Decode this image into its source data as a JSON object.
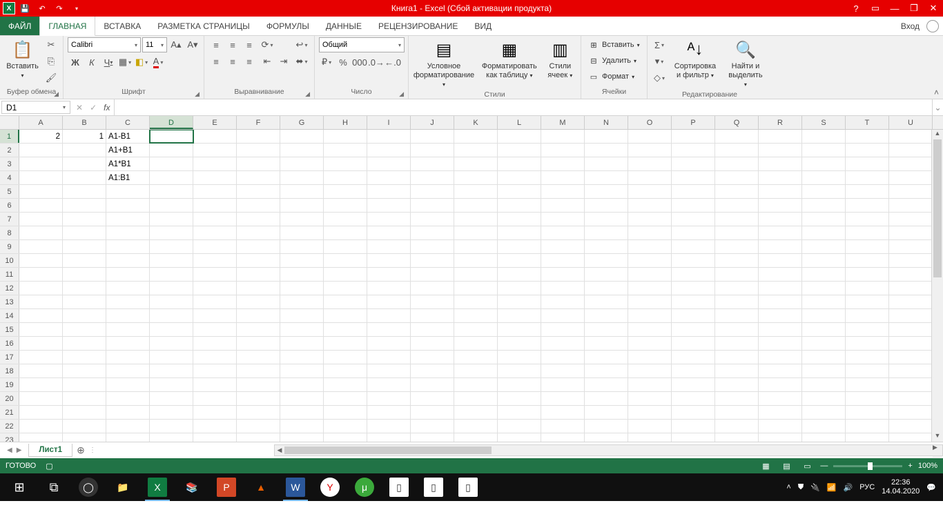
{
  "titlebar": {
    "title": "Книга1 -  Excel (Сбой активации продукта)"
  },
  "tabs": {
    "file": "ФАЙЛ",
    "items": [
      "ГЛАВНАЯ",
      "ВСТАВКА",
      "РАЗМЕТКА СТРАНИЦЫ",
      "ФОРМУЛЫ",
      "ДАННЫЕ",
      "РЕЦЕНЗИРОВАНИЕ",
      "ВИД"
    ],
    "active": 0,
    "signin": "Вход"
  },
  "ribbon": {
    "clipboard": {
      "paste": "Вставить",
      "label": "Буфер обмена"
    },
    "font": {
      "name": "Calibri",
      "size": "11",
      "label": "Шрифт",
      "bold": "Ж",
      "italic": "К",
      "underline": "Ч"
    },
    "alignment": {
      "label": "Выравнивание"
    },
    "number": {
      "format": "Общий",
      "label": "Число"
    },
    "styles": {
      "cond": "Условное форматирование",
      "table": "Форматировать как таблицу",
      "cell": "Стили ячеек",
      "label": "Стили"
    },
    "cells": {
      "insert": "Вставить",
      "delete": "Удалить",
      "format": "Формат",
      "label": "Ячейки"
    },
    "editing": {
      "sort": "Сортировка и фильтр",
      "find": "Найти и выделить",
      "label": "Редактирование"
    }
  },
  "formula_bar": {
    "name": "D1",
    "fx": "fx",
    "value": ""
  },
  "grid": {
    "columns": [
      "A",
      "B",
      "C",
      "D",
      "E",
      "F",
      "G",
      "H",
      "I",
      "J",
      "K",
      "L",
      "M",
      "N",
      "O",
      "P",
      "Q",
      "R",
      "S",
      "T",
      "U"
    ],
    "active_col": 3,
    "active_row": 0,
    "row_count": 23,
    "cells": {
      "A1": "2",
      "B1": "1",
      "C1": "A1-B1",
      "C2": "A1+B1",
      "C3": "A1*B1",
      "C4": "A1:B1"
    }
  },
  "sheets": {
    "tab": "Лист1"
  },
  "statusbar": {
    "ready": "ГОТОВО",
    "zoom": "100%"
  },
  "taskbar": {
    "lang": "РУС",
    "time": "22:36",
    "date": "14.04.2020"
  }
}
